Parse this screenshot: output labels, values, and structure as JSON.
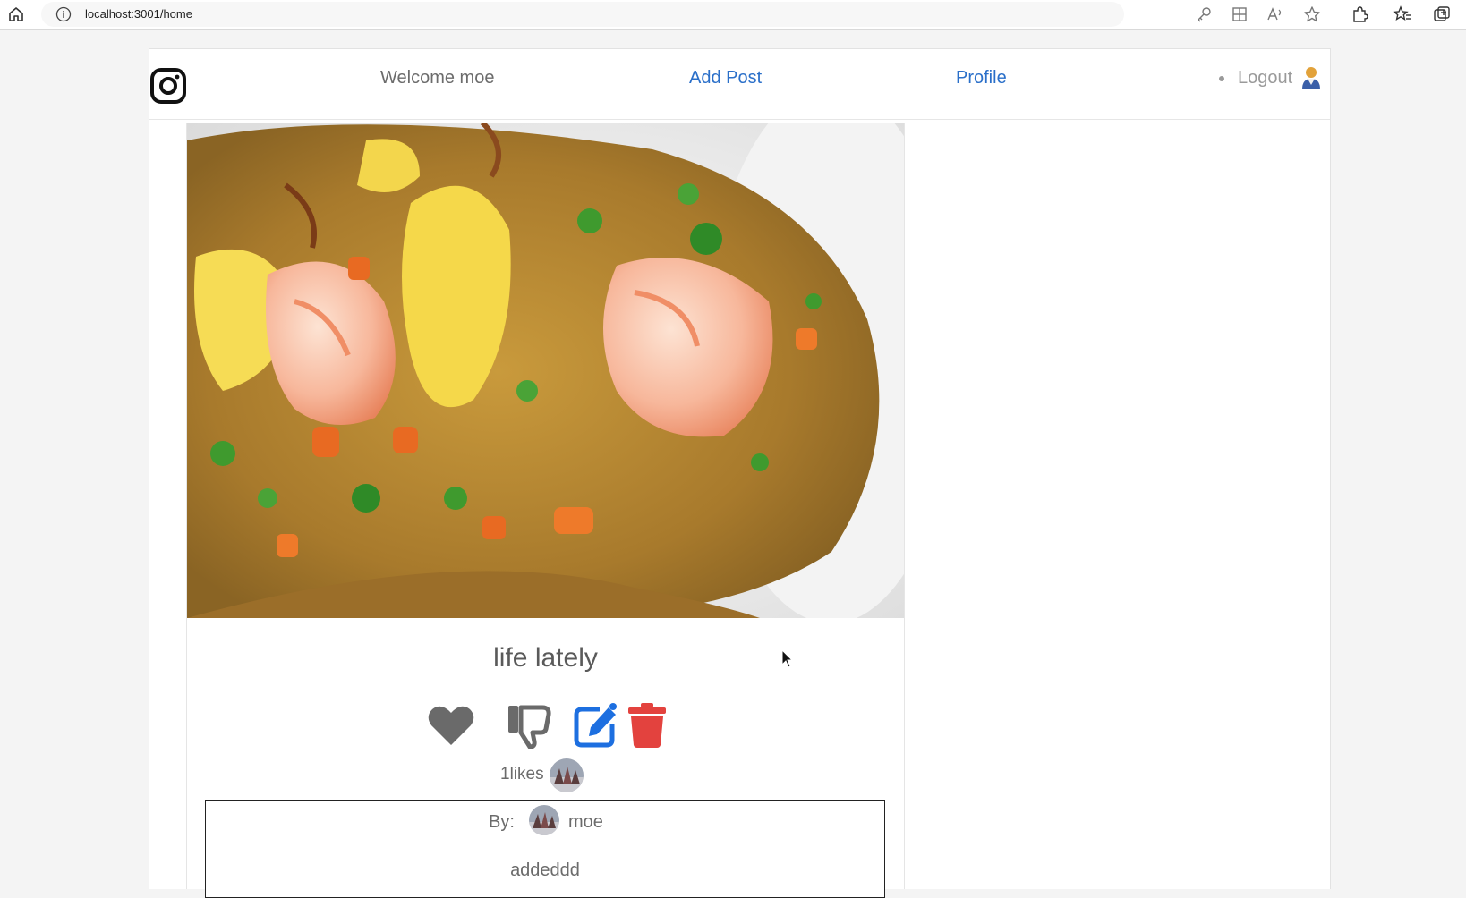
{
  "browser": {
    "url": "localhost:3001/home",
    "icons": [
      "home-icon",
      "info-icon",
      "key-icon",
      "grid-icon",
      "read-aloud-icon",
      "star-icon",
      "extensions-icon",
      "favorites-icon",
      "collections-icon"
    ]
  },
  "navbar": {
    "logo": "instagram-icon",
    "welcome": "Welcome moe",
    "add_post": "Add Post",
    "profile": "Profile",
    "logout": "Logout"
  },
  "post": {
    "image_alt": "fried rice with shrimp",
    "title": "life lately",
    "actions": [
      "heart-icon",
      "thumbs-down-icon",
      "edit-icon",
      "trash-icon"
    ],
    "likes_text": "1likes",
    "comment": {
      "by_label": "By:",
      "author": "moe",
      "text": "addeddd"
    }
  },
  "colors": {
    "link_blue": "#2a6fc9",
    "edit_blue": "#1d6fe0",
    "delete_red": "#e3423e",
    "icon_gray": "#6a6a6a"
  }
}
